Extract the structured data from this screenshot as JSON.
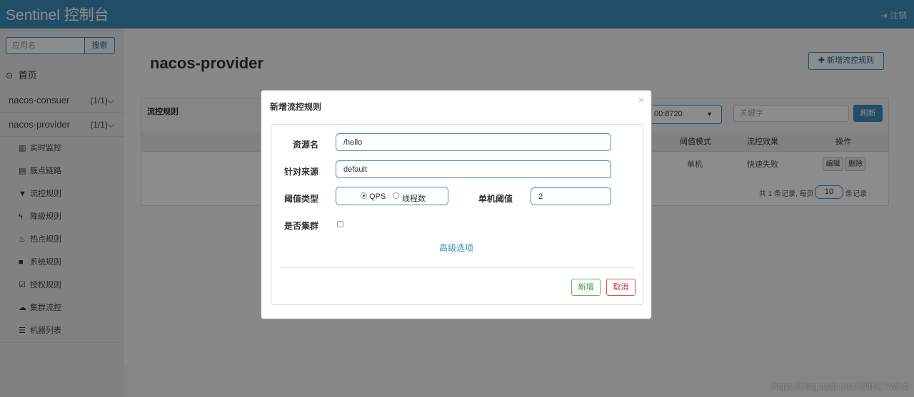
{
  "app": {
    "title": "Sentinel 控制台",
    "logout": "注销",
    "logout_icon": "sign-out-icon"
  },
  "sidebar": {
    "search_placeholder": "应用名",
    "search_button": "搜索",
    "home": {
      "label": "首页",
      "icon": "clock-icon"
    },
    "apps": [
      {
        "name": "nacos-consuer",
        "count": "(1/1)",
        "chevron": "⌵"
      },
      {
        "name": "nacos-provider",
        "count": "(1/1)",
        "chevron": "⌵"
      }
    ],
    "items": [
      {
        "label": "实时监控",
        "icon": "bar-chart-icon"
      },
      {
        "label": "簇点链路",
        "icon": "list-icon"
      },
      {
        "label": "流控规则",
        "icon": "filter-icon"
      },
      {
        "label": "降级规则",
        "icon": "bolt-icon"
      },
      {
        "label": "热点规则",
        "icon": "fire-icon"
      },
      {
        "label": "系统规则",
        "icon": "lock-icon"
      },
      {
        "label": "授权规则",
        "icon": "check-square-icon"
      },
      {
        "label": "集群流控",
        "icon": "cloud-icon"
      },
      {
        "label": "机器列表",
        "icon": "server-list-icon"
      }
    ]
  },
  "main": {
    "title": "nacos-provider",
    "add_rule_button": "新增流控规则",
    "panel": {
      "title": "流控规则",
      "machine_value": "00:8720",
      "keyword_placeholder": "关键字",
      "refresh_button": "刷新",
      "columns": [
        "阈值模式",
        "流控效果",
        "操作"
      ],
      "row": {
        "mode": "单机",
        "effect": "快速失败",
        "edit": "编辑",
        "delete": "删除"
      },
      "pager": {
        "prefix": "共 1 条记录, 每页",
        "page_size": "10",
        "suffix": "条记录"
      }
    }
  },
  "modal": {
    "title": "新增流控规则",
    "close": "×",
    "resource_label": "资源名",
    "resource_value": "/hello",
    "source_label": "针对来源",
    "source_value": "default",
    "threshold_type_label": "阈值类型",
    "threshold_options": [
      "QPS",
      "线程数"
    ],
    "threshold_selected": "QPS",
    "single_threshold_label": "单机阈值",
    "single_threshold_value": "2",
    "cluster_label": "是否集群",
    "advanced_link": "高级选项",
    "submit_button": "新增",
    "cancel_button": "取消"
  },
  "watermark": "https://blog.csdn.net/WithCYwind"
}
